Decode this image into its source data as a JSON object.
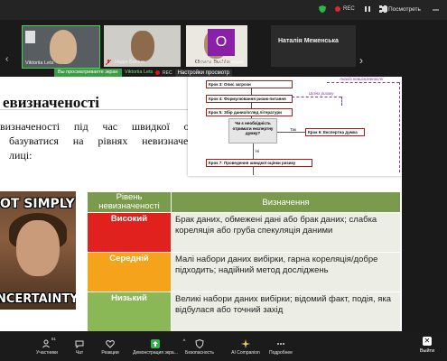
{
  "window": {
    "record_label": "REC",
    "view_button": "Посмотреть"
  },
  "participants": [
    {
      "name": "Viktoriia Lets",
      "name_color": "#ffffff",
      "active_border": "#3cd74f"
    },
    {
      "name": "Надія Боніно",
      "name_color": "#ffffff"
    },
    {
      "name": "Oksana Buchko",
      "name_color": "#ffffff"
    },
    {
      "name": "Наталия Меженська",
      "initial": "O",
      "avatar_color": "#8a1fa8"
    },
    {
      "name": "Наталія Меженська",
      "big": true
    }
  ],
  "share_bar": {
    "tag": "Вы просматриваете экран",
    "presenter": "Viktoriia Lets",
    "rec": "REC",
    "settings": "Настройки просмотр"
  },
  "slide": {
    "title": "евизначеності",
    "body": {
      "line1": "визначеності під час швидкої оцінки",
      "line2": "базуватися на рівнях невизначеності,",
      "line3": "лиці:"
    },
    "flowchart": {
      "analysis_note": "Аналіз невизначеності",
      "framing_note": "Шліях ризику",
      "steps": [
        "Крок 3: Опис загрози",
        "Крок 4: Формулювання ризик-питання",
        "Крок 5: Збір даних/огляд літератури",
        "Крок 6: Експертна думка",
        "Крок 7: Проведення швидкої оцінки ризику"
      ],
      "decision": "Чи є необхідність отримати експертну думку?",
      "yes_label": "Так",
      "no_label": "Ні"
    },
    "meme": {
      "top": "OT SIMPLY",
      "bottom": "NCERTAINTY"
    },
    "table": {
      "headers": [
        "Рівень невизначеності",
        "Визначення"
      ],
      "rows": [
        {
          "level": "Високий",
          "color": "#e0211e",
          "definition": "Брак даних, обмежені дані або брак даних; слабка кореляція або груба спекуляція даними"
        },
        {
          "level": "Середній",
          "color": "#f5a31a",
          "definition": "Малі набори даних вибірки, гарна кореляція/добре підходить; надійний метод досліджень"
        },
        {
          "level": "Низький",
          "color": "#8bb856",
          "definition": "Великі набори даних вибірки; відомий факт, подія, яка відбулася або точний захід"
        }
      ]
    }
  },
  "toolbar": {
    "participants": "Участники",
    "participants_count": "51",
    "chat": "Чат",
    "reactions": "Реакции",
    "share_screen": "Демонстрация экра...",
    "security": "Безопасность",
    "ai_companion": "AI Companion",
    "more": "Подробнее",
    "leave": "Выйти"
  }
}
